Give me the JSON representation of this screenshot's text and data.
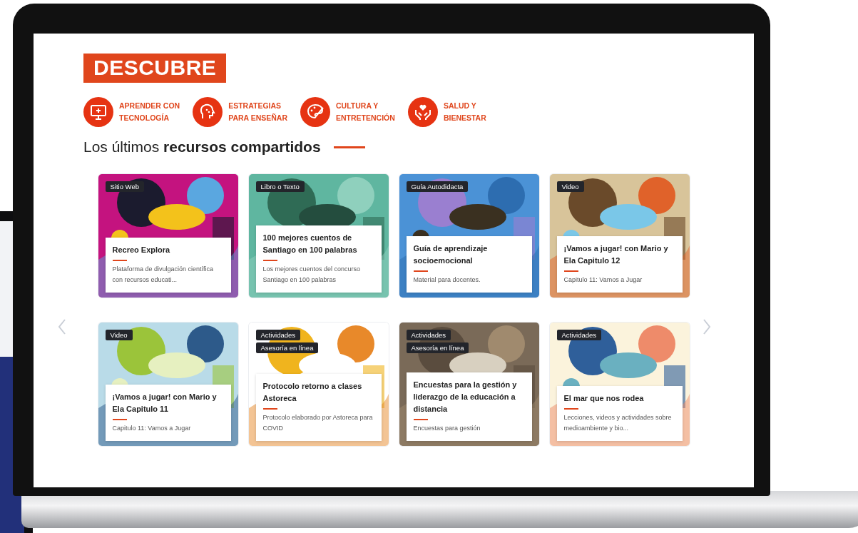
{
  "badge": "DESCUBRE",
  "categories": [
    {
      "label_lines": [
        "APRENDER CON",
        "TECNOLOGÍA"
      ],
      "kind": "monitor"
    },
    {
      "label_lines": [
        "ESTRATEGIAS",
        "PARA ENSEÑAR"
      ],
      "kind": "head"
    },
    {
      "label_lines": [
        "CULTURA Y",
        "ENTRETENCIÓN"
      ],
      "kind": "palette"
    },
    {
      "label_lines": [
        "SALUD Y",
        "BIENESTAR"
      ],
      "kind": "hands"
    }
  ],
  "heading": "Los últimos **recursos compartidos**",
  "cards": [
    {
      "tags": [
        "Sitio Web"
      ],
      "title": "Recreo Explora",
      "description": "Plataforma de divulgación científica con recursos educati..."
    },
    {
      "tags": [
        "Libro o Texto"
      ],
      "title": "100 mejores cuentos de Santiago en 100 palabras",
      "description": "Los mejores cuentos del concurso Santiago en 100 palabras"
    },
    {
      "tags": [
        "Guía Autodidacta"
      ],
      "title": "Guía de aprendizaje socioemocional",
      "description": "Material para docentes."
    },
    {
      "tags": [
        "Video"
      ],
      "title": "¡Vamos a jugar! con Mario y Ela Capitulo 12",
      "description": "Capitulo 11: Vamos a Jugar"
    },
    {
      "tags": [
        "Video"
      ],
      "title": "¡Vamos a jugar! con Mario y Ela Capitulo 11",
      "description": "Capitulo 11: Vamos a Jugar"
    },
    {
      "tags": [
        "Actividades",
        "Asesoría en línea"
      ],
      "title": "Protocolo retorno a clases Astoreca",
      "description": "Protocolo elaborado por Astoreca para COVID"
    },
    {
      "tags": [
        "Actividades",
        "Asesoría en línea"
      ],
      "title": "Encuestas para la gestión y liderazgo de la educación a distancia",
      "description": "Encuestas para gestión"
    },
    {
      "tags": [
        "Actividades"
      ],
      "title": "El mar que nos rodea",
      "description": "Lecciones, videos y actividades sobre medioambiente y bio..."
    }
  ]
}
